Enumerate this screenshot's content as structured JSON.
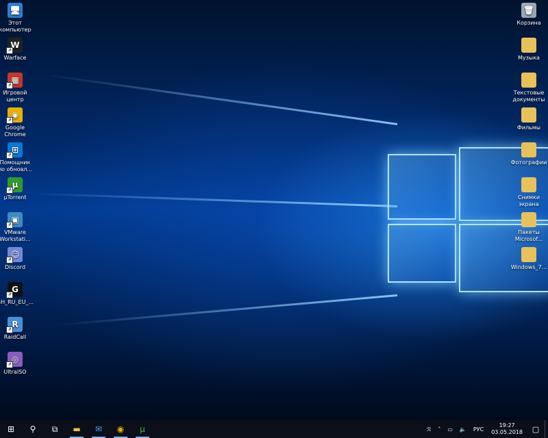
{
  "desktop": {
    "left_icons": [
      {
        "label": "Этот компьютер",
        "icon": "computer-icon",
        "glyph": "🖥",
        "color": "#2a7fd4"
      },
      {
        "label": "Warface",
        "icon": "warface-icon",
        "glyph": "W",
        "color": "#222222"
      },
      {
        "label": "Игровой центр",
        "icon": "game-center-icon",
        "glyph": "▦",
        "color": "#c0392b"
      },
      {
        "label": "Google Chrome",
        "icon": "chrome-icon",
        "glyph": "◉",
        "color": "#e8b100"
      },
      {
        "label": "Помощник по обновл...",
        "icon": "windows-update-icon",
        "glyph": "⊞",
        "color": "#0a78d7"
      },
      {
        "label": "µTorrent",
        "icon": "utorrent-icon",
        "glyph": "µ",
        "color": "#2e9b2e"
      },
      {
        "label": "VMware Workstati...",
        "icon": "vmware-icon",
        "glyph": "▣",
        "color": "#3d8cc4"
      },
      {
        "label": "Discord",
        "icon": "discord-icon",
        "glyph": "☺",
        "color": "#7289da"
      },
      {
        "label": "GH_RU_EU_...",
        "icon": "gh-icon",
        "glyph": "G",
        "color": "#111111"
      },
      {
        "label": "RaidCall",
        "icon": "raidcall-icon",
        "glyph": "R",
        "color": "#4a90d9"
      },
      {
        "label": "UltraISO",
        "icon": "ultraiso-icon",
        "glyph": "◎",
        "color": "#8a5cc0"
      }
    ],
    "right_icons": [
      {
        "label": "Корзина",
        "icon": "recycle-bin-icon",
        "glyph": "🗑",
        "color": "#9aa7b3"
      },
      {
        "label": "Музыка",
        "icon": "folder-icon",
        "glyph": "",
        "color": "#e8c15a"
      },
      {
        "label": "Текстовые документы",
        "icon": "folder-icon",
        "glyph": "",
        "color": "#e8c15a"
      },
      {
        "label": "Фильмы",
        "icon": "folder-icon",
        "glyph": "",
        "color": "#e8c15a"
      },
      {
        "label": "Фотографии",
        "icon": "folder-icon",
        "glyph": "",
        "color": "#e8c15a"
      },
      {
        "label": "Снимки экрана",
        "icon": "folder-icon",
        "glyph": "",
        "color": "#e8c15a"
      },
      {
        "label": "Пакеты Microsof...",
        "icon": "folder-icon",
        "glyph": "",
        "color": "#e8c15a"
      },
      {
        "label": "Windows_7...",
        "icon": "folder-icon",
        "glyph": "",
        "color": "#e8c15a"
      }
    ]
  },
  "taskbar": {
    "buttons": [
      {
        "name": "start-button",
        "glyph": "⊞",
        "color": "#ffffff"
      },
      {
        "name": "search-button",
        "glyph": "⚲",
        "color": "#ffffff"
      },
      {
        "name": "task-view-button",
        "glyph": "⧉",
        "color": "#ffffff"
      },
      {
        "name": "file-explorer-button",
        "glyph": "▬",
        "color": "#f0c04a"
      },
      {
        "name": "mail-button",
        "glyph": "✉",
        "color": "#4aa3ff"
      },
      {
        "name": "chrome-button",
        "glyph": "◉",
        "color": "#e8b100"
      },
      {
        "name": "utorrent-button",
        "glyph": "µ",
        "color": "#3fbf3f"
      }
    ],
    "tray": {
      "people_glyph": "ℛ",
      "chevron_glyph": "˄",
      "network_glyph": "▭",
      "volume_glyph": "🔈",
      "language": "РУС",
      "time": "19:27",
      "date": "03.05.2018",
      "notifications_glyph": "▢"
    }
  }
}
